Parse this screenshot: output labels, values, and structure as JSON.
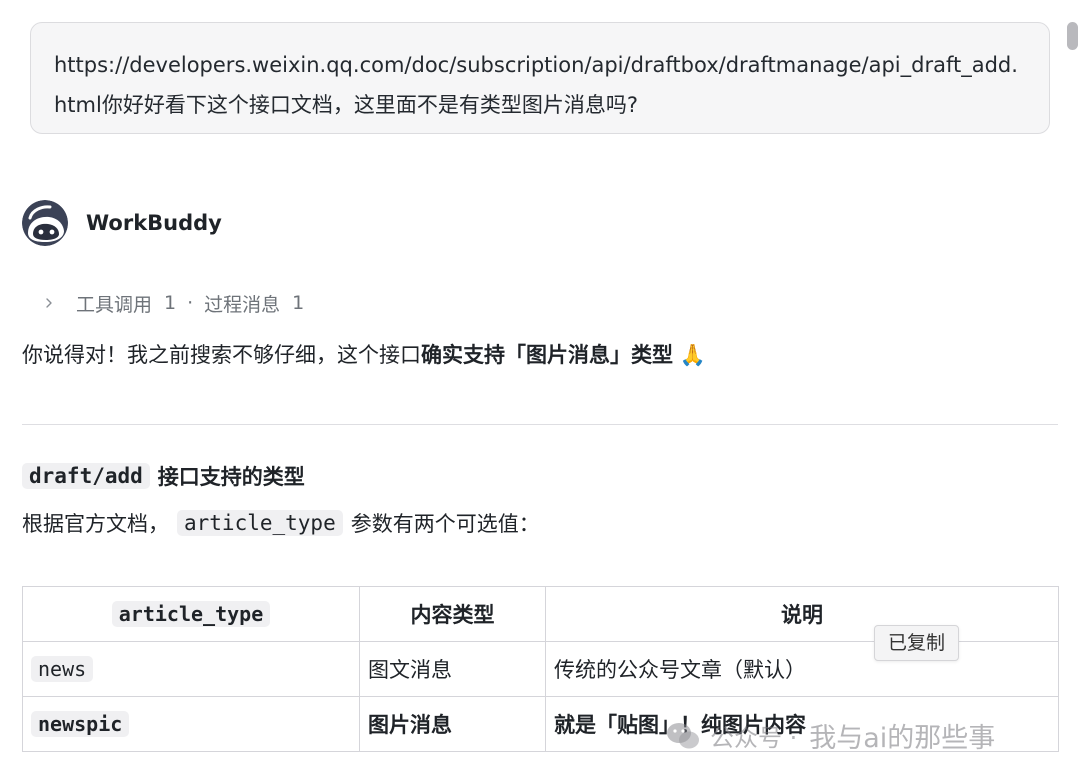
{
  "user_message": {
    "text": "https://developers.weixin.qq.com/doc/subscription/api/draftbox/draftmanage/api_draft_add.html你好好看下这个接口文档，这里面不是有类型图片消息吗?"
  },
  "assistant": {
    "name": "WorkBuddy",
    "avatar_icon": "robot-avatar-icon"
  },
  "process": {
    "tool_calls_label": "工具调用",
    "tool_calls_count": "1",
    "separator": "·",
    "process_msgs_label": "过程消息",
    "process_msgs_count": "1"
  },
  "reply": {
    "prefix": "你说得对！我之前搜索不够仔细，这个接口",
    "bold": "确实支持「图片消息」类型",
    "emoji": "🙏"
  },
  "section": {
    "code": "draft/add",
    "title": "接口支持的类型",
    "desc_prefix": "根据官方文档，",
    "desc_code": "article_type",
    "desc_suffix": "参数有两个可选值："
  },
  "table": {
    "headers": [
      "article_type",
      "内容类型",
      "说明"
    ],
    "rows": [
      [
        "news",
        "图文消息",
        "传统的公众号文章（默认）"
      ],
      [
        "newspic",
        "图片消息",
        "就是「贴图」！纯图片内容"
      ]
    ]
  },
  "toast": {
    "text": "已复制"
  },
  "watermark": {
    "source": "公众号 ·",
    "name": "我与ai的那些事"
  }
}
